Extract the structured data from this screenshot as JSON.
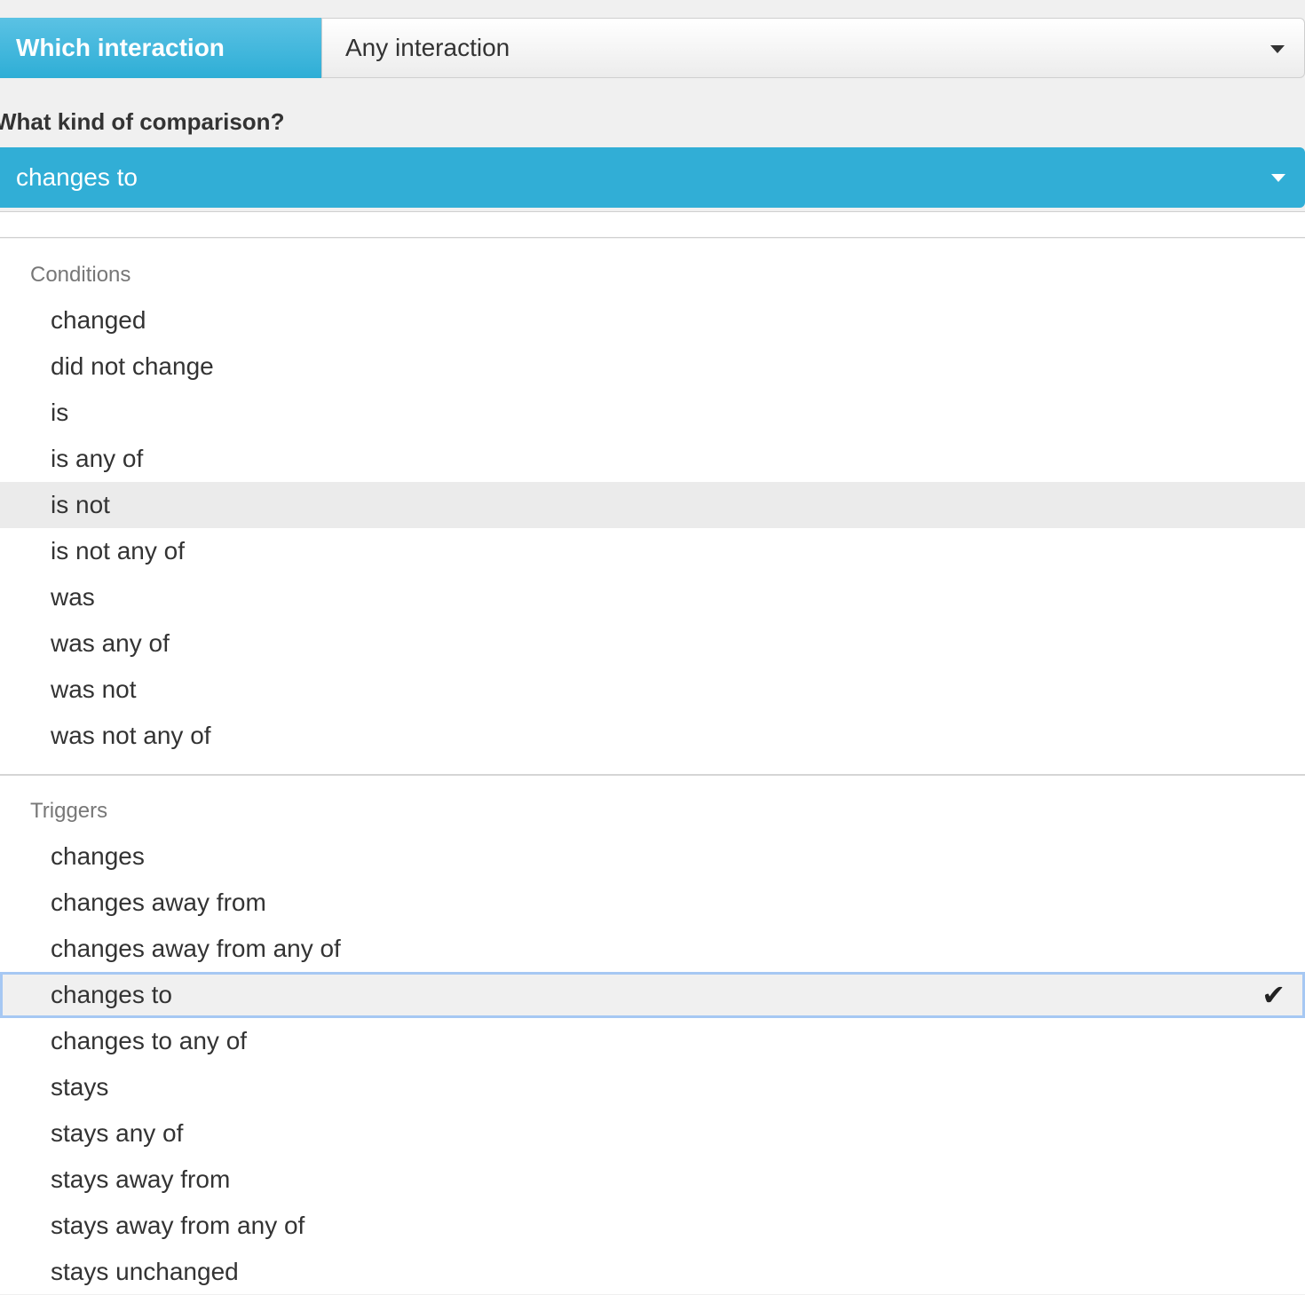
{
  "interaction": {
    "label": "Which interaction",
    "selected": "Any interaction"
  },
  "comparison": {
    "heading": "What kind of comparison?",
    "selected": "changes to"
  },
  "menu": {
    "conditions_header": "Conditions",
    "conditions": [
      "changed",
      "did not change",
      "is",
      "is any of",
      "is not",
      "is not any of",
      "was",
      "was any of",
      "was not",
      "was not any of"
    ],
    "triggers_header": "Triggers",
    "triggers": [
      "changes",
      "changes away from",
      "changes away from any of",
      "changes to",
      "changes to any of",
      "stays",
      "stays any of",
      "stays away from",
      "stays away from any of",
      "stays unchanged"
    ],
    "hovered_option": "is not",
    "selected_option": "changes to",
    "check_icon": "check-icon",
    "caret_icon": "caret-down-icon"
  },
  "colors": {
    "accent": "#31aed6",
    "selected_outline": "#a6c8f3",
    "hover": "#ebebeb"
  }
}
